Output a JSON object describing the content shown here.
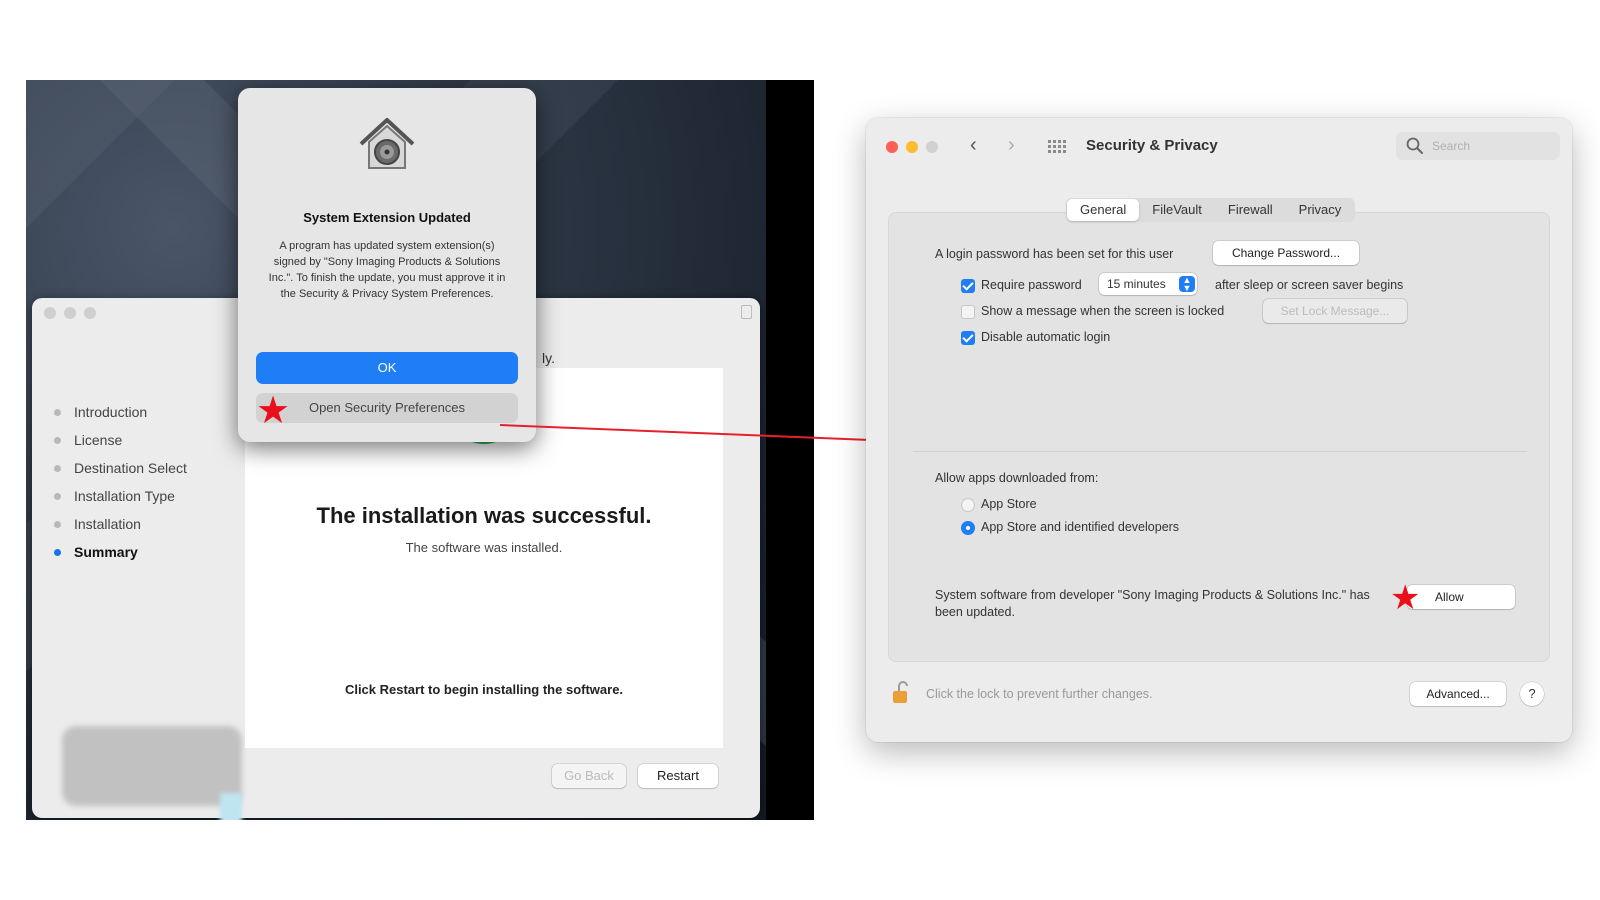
{
  "colors": {
    "accent_blue": "#1f7ef5",
    "success_green": "#2cb84a",
    "annotation_red": "#e8101a",
    "close_red": "#fe5f57",
    "minimize_yellow": "#febc2e",
    "zoom_gray": "#d0d0d0"
  },
  "installer": {
    "steps": [
      {
        "label": "Introduction",
        "active": false
      },
      {
        "label": "License",
        "active": false
      },
      {
        "label": "Destination Select",
        "active": false
      },
      {
        "label": "Installation Type",
        "active": false
      },
      {
        "label": "Installation",
        "active": false
      },
      {
        "label": "Summary",
        "active": true
      }
    ],
    "partial_text": "ly.",
    "success_title": "The installation was successful.",
    "success_subtitle": "The software was installed.",
    "restart_note": "Click Restart to begin installing the software.",
    "go_back_label": "Go Back",
    "restart_label": "Restart"
  },
  "alert": {
    "icon": "security-house-lock-icon",
    "title": "System Extension Updated",
    "body": "A program has updated system extension(s) signed by \"Sony Imaging Products & Solutions Inc.\". To finish the update, you must approve it in the Security & Privacy System Preferences.",
    "ok_label": "OK",
    "open_prefs_label": "Open Security Preferences"
  },
  "prefs": {
    "title": "Security & Privacy",
    "search_placeholder": "Search",
    "tabs": [
      {
        "label": "General",
        "selected": true
      },
      {
        "label": "FileVault",
        "selected": false
      },
      {
        "label": "Firewall",
        "selected": false
      },
      {
        "label": "Privacy",
        "selected": false
      }
    ],
    "login_password_text": "A login password has been set for this user",
    "change_password_label": "Change Password...",
    "require_password_label": "Require password",
    "require_password_checked": true,
    "require_password_delay": "15 minutes",
    "after_sleep_text": "after sleep or screen saver begins",
    "show_message_label": "Show a message when the screen is locked",
    "show_message_checked": false,
    "set_lock_message_label": "Set Lock Message...",
    "disable_auto_login_label": "Disable automatic login",
    "disable_auto_login_checked": true,
    "allow_apps_heading": "Allow apps downloaded from:",
    "allow_options": [
      {
        "label": "App Store",
        "selected": false
      },
      {
        "label": "App Store and identified developers",
        "selected": true
      }
    ],
    "blocked_software_text": "System software from developer \"Sony Imaging Products & Solutions Inc.\" has been updated.",
    "allow_label": "Allow",
    "lock_text": "Click the lock to prevent further changes.",
    "advanced_label": "Advanced...",
    "help_label": "?"
  }
}
